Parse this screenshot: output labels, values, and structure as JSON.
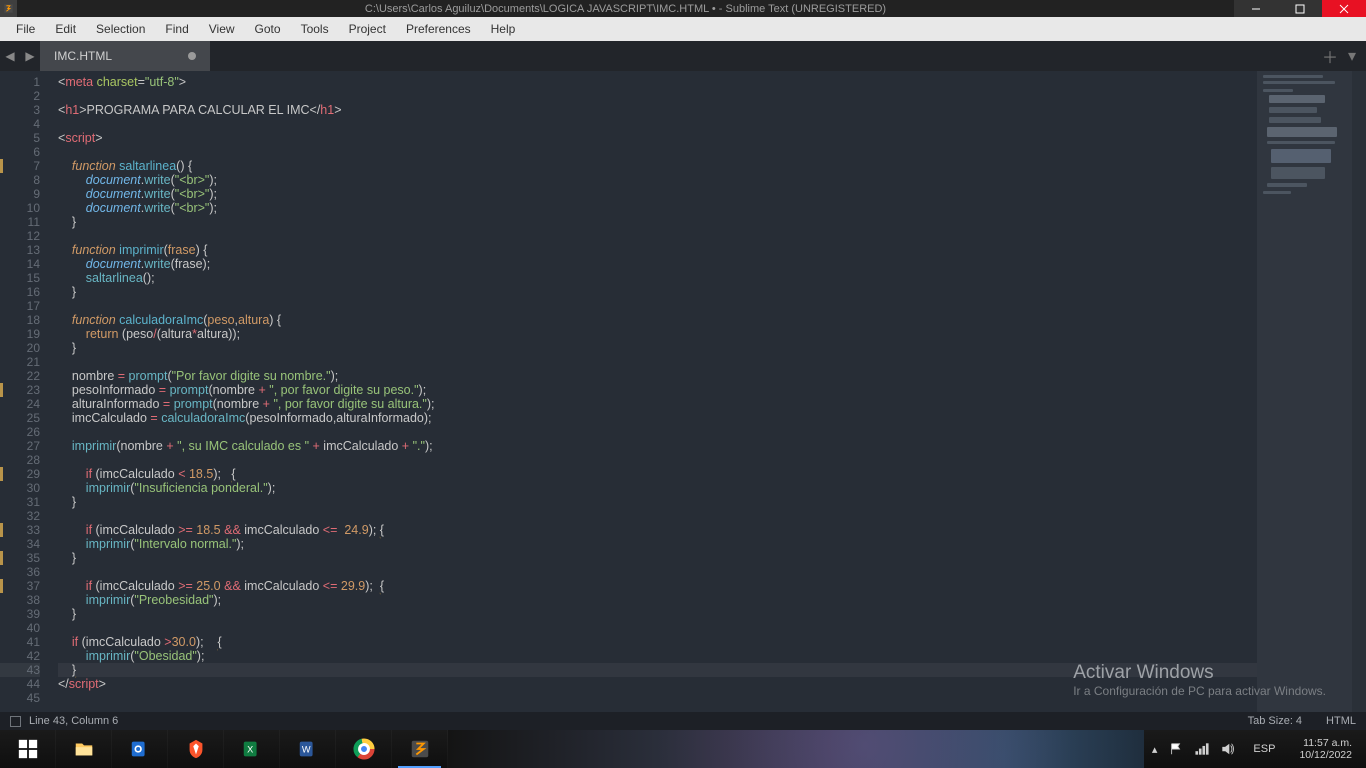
{
  "window": {
    "title": "C:\\Users\\Carlos Aguiluz\\Documents\\LOGICA JAVASCRIPT\\IMC.HTML • - Sublime Text (UNREGISTERED)"
  },
  "menu": [
    "File",
    "Edit",
    "Selection",
    "Find",
    "View",
    "Goto",
    "Tools",
    "Project",
    "Preferences",
    "Help"
  ],
  "tab": {
    "name": "IMC.HTML"
  },
  "status": {
    "left": "Line 43, Column 6",
    "tabsize": "Tab Size: 4",
    "lang": "HTML"
  },
  "watermark": {
    "line1": "Activar Windows",
    "line2": "Ir a Configuración de PC para activar Windows."
  },
  "taskbar": {
    "lang": "ESP",
    "time": "11:57 a.m.",
    "date": "10/12/2022"
  },
  "code": {
    "lines": 45,
    "modified_lines": [
      7,
      23,
      29,
      33,
      35,
      37,
      43
    ],
    "current_line": 43,
    "content": [
      {
        "n": 1,
        "t": [
          [
            "pnc",
            "<"
          ],
          [
            "tag",
            "meta "
          ],
          [
            "attr",
            "charset"
          ],
          [
            "pnc",
            "="
          ],
          [
            "str",
            "\"utf-8\""
          ],
          [
            "pnc",
            ">"
          ]
        ]
      },
      {
        "n": 2,
        "t": []
      },
      {
        "n": 3,
        "t": [
          [
            "pnc",
            "<"
          ],
          [
            "tag",
            "h1"
          ],
          [
            "pnc",
            ">"
          ],
          [
            "var",
            "PROGRAMA PARA CALCULAR EL IMC"
          ],
          [
            "pnc",
            "</"
          ],
          [
            "tag",
            "h1"
          ],
          [
            "pnc",
            ">"
          ]
        ]
      },
      {
        "n": 4,
        "t": []
      },
      {
        "n": 5,
        "t": [
          [
            "pnc",
            "<"
          ],
          [
            "tag",
            "script"
          ],
          [
            "pnc",
            ">"
          ]
        ]
      },
      {
        "n": 6,
        "t": []
      },
      {
        "n": 7,
        "t": [
          [
            "pnc",
            "    "
          ],
          [
            "key",
            "function"
          ],
          [
            "pnc",
            " "
          ],
          [
            "fn",
            "saltarlinea"
          ],
          [
            "pnc",
            "() {"
          ]
        ]
      },
      {
        "n": 8,
        "t": [
          [
            "pnc",
            "        "
          ],
          [
            "fn2",
            "document"
          ],
          [
            "pnc",
            "."
          ],
          [
            "call",
            "write"
          ],
          [
            "pnc",
            "("
          ],
          [
            "str",
            "\"<br>\""
          ],
          [
            "pnc",
            ");"
          ]
        ]
      },
      {
        "n": 9,
        "t": [
          [
            "pnc",
            "        "
          ],
          [
            "fn2",
            "document"
          ],
          [
            "pnc",
            "."
          ],
          [
            "call",
            "write"
          ],
          [
            "pnc",
            "("
          ],
          [
            "str",
            "\"<br>\""
          ],
          [
            "pnc",
            ");"
          ]
        ]
      },
      {
        "n": 10,
        "t": [
          [
            "pnc",
            "        "
          ],
          [
            "fn2",
            "document"
          ],
          [
            "pnc",
            "."
          ],
          [
            "call",
            "write"
          ],
          [
            "pnc",
            "("
          ],
          [
            "str",
            "\"<br>\""
          ],
          [
            "pnc",
            ");"
          ]
        ]
      },
      {
        "n": 11,
        "t": [
          [
            "pnc",
            "    }"
          ]
        ]
      },
      {
        "n": 12,
        "t": []
      },
      {
        "n": 13,
        "t": [
          [
            "pnc",
            "    "
          ],
          [
            "key",
            "function"
          ],
          [
            "pnc",
            " "
          ],
          [
            "fn",
            "imprimir"
          ],
          [
            "pnc",
            "("
          ],
          [
            "num",
            "frase"
          ],
          [
            "pnc",
            ") {"
          ]
        ]
      },
      {
        "n": 14,
        "t": [
          [
            "pnc",
            "        "
          ],
          [
            "fn2",
            "document"
          ],
          [
            "pnc",
            "."
          ],
          [
            "call",
            "write"
          ],
          [
            "pnc",
            "(frase);"
          ]
        ]
      },
      {
        "n": 15,
        "t": [
          [
            "pnc",
            "        "
          ],
          [
            "call",
            "saltarlinea"
          ],
          [
            "pnc",
            "();"
          ]
        ]
      },
      {
        "n": 16,
        "t": [
          [
            "pnc",
            "    }"
          ]
        ]
      },
      {
        "n": 17,
        "t": []
      },
      {
        "n": 18,
        "t": [
          [
            "pnc",
            "    "
          ],
          [
            "key",
            "function"
          ],
          [
            "pnc",
            " "
          ],
          [
            "fn",
            "calculadoraImc"
          ],
          [
            "pnc",
            "("
          ],
          [
            "num",
            "peso"
          ],
          [
            "pnc",
            ","
          ],
          [
            "num",
            "altura"
          ],
          [
            "pnc",
            ") {"
          ]
        ]
      },
      {
        "n": 19,
        "t": [
          [
            "pnc",
            "        "
          ],
          [
            "key2",
            "return"
          ],
          [
            "pnc",
            " (peso"
          ],
          [
            "op",
            "/"
          ],
          [
            "pnc",
            "(altura"
          ],
          [
            "op",
            "*"
          ],
          [
            "pnc",
            "altura));"
          ]
        ]
      },
      {
        "n": 20,
        "t": [
          [
            "pnc",
            "    }"
          ]
        ]
      },
      {
        "n": 21,
        "t": []
      },
      {
        "n": 22,
        "t": [
          [
            "pnc",
            "    nombre "
          ],
          [
            "op",
            "="
          ],
          [
            "pnc",
            " "
          ],
          [
            "call",
            "prompt"
          ],
          [
            "pnc",
            "("
          ],
          [
            "str",
            "\"Por favor digite su nombre.\""
          ],
          [
            "pnc",
            ");"
          ]
        ]
      },
      {
        "n": 23,
        "t": [
          [
            "pnc",
            "    pesoInformado "
          ],
          [
            "op",
            "="
          ],
          [
            "pnc",
            " "
          ],
          [
            "call",
            "prompt"
          ],
          [
            "pnc",
            "(nombre "
          ],
          [
            "op",
            "+"
          ],
          [
            "pnc",
            " "
          ],
          [
            "str",
            "\", por favor digite su peso.\""
          ],
          [
            "pnc",
            ");"
          ]
        ]
      },
      {
        "n": 24,
        "t": [
          [
            "pnc",
            "    alturaInformado "
          ],
          [
            "op",
            "="
          ],
          [
            "pnc",
            " "
          ],
          [
            "call",
            "prompt"
          ],
          [
            "pnc",
            "(nombre "
          ],
          [
            "op",
            "+"
          ],
          [
            "pnc",
            " "
          ],
          [
            "str",
            "\", por favor digite su altura.\""
          ],
          [
            "pnc",
            ");"
          ]
        ]
      },
      {
        "n": 25,
        "t": [
          [
            "pnc",
            "    imcCalculado "
          ],
          [
            "op",
            "="
          ],
          [
            "pnc",
            " "
          ],
          [
            "call",
            "calculadoraImc"
          ],
          [
            "pnc",
            "(pesoInformado,alturaInformado);"
          ]
        ]
      },
      {
        "n": 26,
        "t": []
      },
      {
        "n": 27,
        "t": [
          [
            "pnc",
            "    "
          ],
          [
            "call",
            "imprimir"
          ],
          [
            "pnc",
            "(nombre "
          ],
          [
            "op",
            "+"
          ],
          [
            "pnc",
            " "
          ],
          [
            "str",
            "\", su IMC calculado es \""
          ],
          [
            "pnc",
            " "
          ],
          [
            "op",
            "+"
          ],
          [
            "pnc",
            " imcCalculado "
          ],
          [
            "op",
            "+"
          ],
          [
            "pnc",
            " "
          ],
          [
            "str",
            "\".\""
          ],
          [
            "pnc",
            ");"
          ]
        ]
      },
      {
        "n": 28,
        "t": []
      },
      {
        "n": 29,
        "t": [
          [
            "pnc",
            "        "
          ],
          [
            "op",
            "if"
          ],
          [
            "pnc",
            " (imcCalculado "
          ],
          [
            "op",
            "<"
          ],
          [
            "pnc",
            " "
          ],
          [
            "num",
            "18.5"
          ],
          [
            "pnc",
            ");   "
          ],
          [
            "ul",
            "{"
          ]
        ]
      },
      {
        "n": 30,
        "t": [
          [
            "pnc",
            "        "
          ],
          [
            "call",
            "imprimir"
          ],
          [
            "pnc",
            "("
          ],
          [
            "str",
            "\"Insuficiencia ponderal.\""
          ],
          [
            "pnc",
            ");"
          ]
        ]
      },
      {
        "n": 31,
        "t": [
          [
            "pnc",
            "    }"
          ]
        ]
      },
      {
        "n": 32,
        "t": []
      },
      {
        "n": 33,
        "t": [
          [
            "pnc",
            "        "
          ],
          [
            "op",
            "if"
          ],
          [
            "pnc",
            " (imcCalculado "
          ],
          [
            "op",
            ">="
          ],
          [
            "pnc",
            " "
          ],
          [
            "num",
            "18.5"
          ],
          [
            "pnc",
            " "
          ],
          [
            "op",
            "&&"
          ],
          [
            "pnc",
            " imcCalculado "
          ],
          [
            "op",
            "<="
          ],
          [
            "pnc",
            "  "
          ],
          [
            "num",
            "24.9"
          ],
          [
            "pnc",
            "); "
          ],
          [
            "ul",
            "{"
          ]
        ]
      },
      {
        "n": 34,
        "t": [
          [
            "pnc",
            "        "
          ],
          [
            "call",
            "imprimir"
          ],
          [
            "pnc",
            "("
          ],
          [
            "str",
            "\"Intervalo normal.\""
          ],
          [
            "pnc",
            ");"
          ]
        ]
      },
      {
        "n": 35,
        "t": [
          [
            "pnc",
            "    }"
          ]
        ]
      },
      {
        "n": 36,
        "t": []
      },
      {
        "n": 37,
        "t": [
          [
            "pnc",
            "        "
          ],
          [
            "op",
            "if"
          ],
          [
            "pnc",
            " (imcCalculado "
          ],
          [
            "op",
            ">="
          ],
          [
            "pnc",
            " "
          ],
          [
            "num",
            "25.0"
          ],
          [
            "pnc",
            " "
          ],
          [
            "op",
            "&&"
          ],
          [
            "pnc",
            " imcCalculado "
          ],
          [
            "op",
            "<="
          ],
          [
            "pnc",
            " "
          ],
          [
            "num",
            "29.9"
          ],
          [
            "pnc",
            ");  "
          ],
          [
            "ul",
            "{"
          ]
        ]
      },
      {
        "n": 38,
        "t": [
          [
            "pnc",
            "        "
          ],
          [
            "call",
            "imprimir"
          ],
          [
            "pnc",
            "("
          ],
          [
            "str",
            "\"Preobesidad\""
          ],
          [
            "pnc",
            ");"
          ]
        ]
      },
      {
        "n": 39,
        "t": [
          [
            "pnc",
            "    }"
          ]
        ]
      },
      {
        "n": 40,
        "t": []
      },
      {
        "n": 41,
        "t": [
          [
            "pnc",
            "    "
          ],
          [
            "op",
            "if"
          ],
          [
            "pnc",
            " (imcCalculado "
          ],
          [
            "op",
            ">"
          ],
          [
            "num",
            "30.0"
          ],
          [
            "pnc",
            ");    "
          ],
          [
            "ul",
            "{"
          ]
        ]
      },
      {
        "n": 42,
        "t": [
          [
            "pnc",
            "        "
          ],
          [
            "call",
            "imprimir"
          ],
          [
            "pnc",
            "("
          ],
          [
            "str",
            "\"Obesidad\""
          ],
          [
            "pnc",
            ");"
          ]
        ]
      },
      {
        "n": 43,
        "t": [
          [
            "pnc",
            "    "
          ],
          [
            "ul",
            "}"
          ]
        ]
      },
      {
        "n": 44,
        "t": [
          [
            "pnc",
            "</"
          ],
          [
            "tag",
            "script"
          ],
          [
            "pnc",
            ">"
          ]
        ]
      },
      {
        "n": 45,
        "t": []
      }
    ]
  }
}
